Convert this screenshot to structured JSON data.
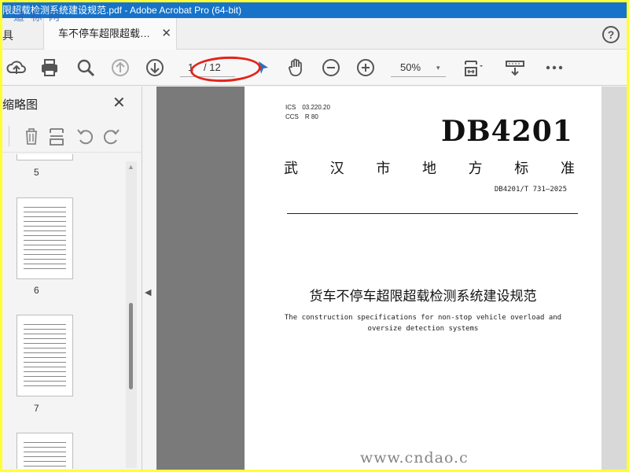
{
  "window": {
    "title": "限超载检测系统建设规范.pdf - Adobe Acrobat Pro (64-bit)"
  },
  "logo_watermark": "道 标 网",
  "tabs": {
    "tools": "具",
    "document": "车不停车超限超载…",
    "close": "✕"
  },
  "toolbar": {
    "current_page": "1",
    "total_pages": "/ 12",
    "zoom": "50%"
  },
  "sidebar": {
    "title": "缩略图",
    "close": "✕",
    "thumbnails": [
      "5",
      "6",
      "7"
    ]
  },
  "document": {
    "ics_label": "ICS",
    "ics_value": "03.220.20",
    "ccs_label": "CCS",
    "ccs_value": "R 80",
    "code": "DB4201",
    "city": [
      "武",
      "汉",
      "市",
      "地",
      "方",
      "标",
      "准"
    ],
    "standard_no": "DB4201/T 731—2025",
    "title_cn": "货车不停车超限超载检测系统建设规范",
    "title_en_1": "The construction specifications for non-stop vehicle overload and",
    "title_en_2": "oversize detection systems"
  },
  "site_watermark": "www.cndao.c",
  "colors": {
    "titlebar": "#1673c9",
    "highlight_ellipse": "#e3241a",
    "border": "#ffff33"
  }
}
